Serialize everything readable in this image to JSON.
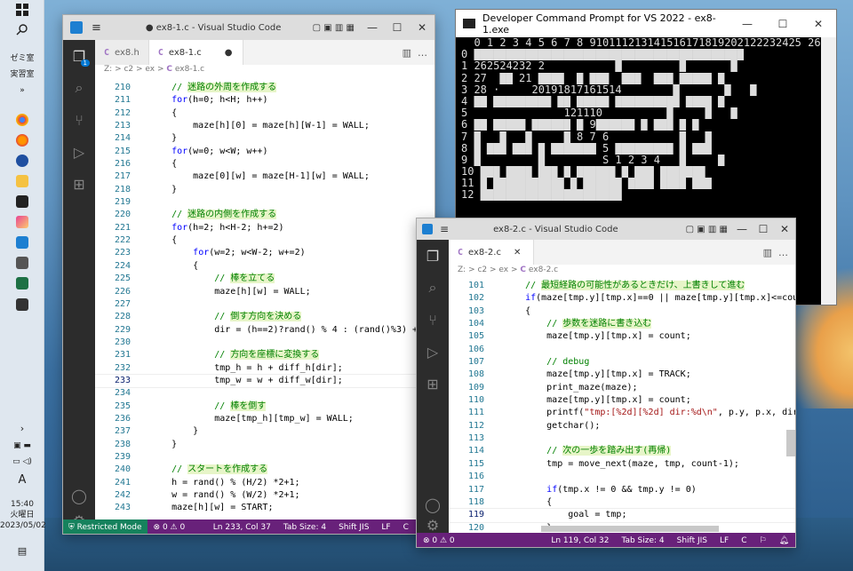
{
  "taskbar": {
    "items": [
      {
        "label": "ゼミ室"
      },
      {
        "label": "実習室"
      },
      {
        "label": "»"
      }
    ],
    "lang": "A",
    "time": "15:40",
    "day": "火曜日",
    "date": "2023/05/02"
  },
  "win1": {
    "title": "● ex8-1.c - Visual Studio Code",
    "tabs": [
      {
        "label": "ex8.h",
        "icon": "C"
      },
      {
        "label": "ex8-1.c",
        "icon": "C",
        "dirty": "●"
      }
    ],
    "breadcrumb": [
      "Z:",
      "c2",
      "ex",
      "C",
      "ex8-1.c"
    ],
    "badge": "1",
    "lines": [
      {
        "n": "210",
        "t": "    // 迷路の外周を作成する"
      },
      {
        "n": "211",
        "t": "    for(h=0; h<H; h++)"
      },
      {
        "n": "212",
        "t": "    {"
      },
      {
        "n": "213",
        "t": "        maze[h][0] = maze[h][W-1] = WALL;"
      },
      {
        "n": "214",
        "t": "    }"
      },
      {
        "n": "215",
        "t": "    for(w=0; w<W; w++)"
      },
      {
        "n": "216",
        "t": "    {"
      },
      {
        "n": "217",
        "t": "        maze[0][w] = maze[H-1][w] = WALL;"
      },
      {
        "n": "218",
        "t": "    }"
      },
      {
        "n": "219",
        "t": ""
      },
      {
        "n": "220",
        "t": "    // 迷路の内側を作成する"
      },
      {
        "n": "221",
        "t": "    for(h=2; h<H-2; h+=2)"
      },
      {
        "n": "222",
        "t": "    {"
      },
      {
        "n": "223",
        "t": "        for(w=2; w<W-2; w+=2)"
      },
      {
        "n": "224",
        "t": "        {"
      },
      {
        "n": "225",
        "t": "            // 棒を立てる"
      },
      {
        "n": "226",
        "t": "            maze[h][w] = WALL;"
      },
      {
        "n": "227",
        "t": ""
      },
      {
        "n": "228",
        "t": "            // 倒す方向を決める"
      },
      {
        "n": "229",
        "t": "            dir = (h==2)?rand() % 4 : (rand()%3) + 1;"
      },
      {
        "n": "230",
        "t": ""
      },
      {
        "n": "231",
        "t": "            // 方向を座標に変換する"
      },
      {
        "n": "232",
        "t": "            tmp_h = h + diff_h[dir];"
      },
      {
        "n": "233",
        "t": "            tmp_w = w + diff_w[dir];"
      },
      {
        "n": "234",
        "t": ""
      },
      {
        "n": "235",
        "t": "            // 棒を倒す"
      },
      {
        "n": "236",
        "t": "            maze[tmp_h][tmp_w] = WALL;"
      },
      {
        "n": "237",
        "t": "        }"
      },
      {
        "n": "238",
        "t": "    }"
      },
      {
        "n": "239",
        "t": ""
      },
      {
        "n": "240",
        "t": "    // スタートを作成する"
      },
      {
        "n": "241",
        "t": "    h = rand() % (H/2) *2+1;"
      },
      {
        "n": "242",
        "t": "    w = rand() % (W/2) *2+1;"
      },
      {
        "n": "243",
        "t": "    maze[h][w] = START;"
      }
    ],
    "status": {
      "mode": "Restricted Mode",
      "problems": "⊗ 0 ⚠ 0",
      "position": "Ln 233, Col 37",
      "tab": "Tab Size: 4",
      "encoding": "Shift JIS",
      "eol": "LF",
      "lang": "C"
    }
  },
  "console": {
    "title": "Developer Command Prompt for VS 2022 - ex8-1.exe",
    "lines": [
      "  0 1 2 3 4 5 6 7 8 910111213141516171819202122232425 26",
      "0 ██████████████████████████████████████████",
      "1 262524232 2           █         █       █",
      "2 27  ██ 21 ████  █ ███  ███  ███ █████ █",
      "3 28 ·     20191817161514        █       █   █",
      "4 ██ █████████ ██ █████ ██████████ ████ █",
      "5               121110          █     █   █",
      "6 ██ █████ ██████ █ 9██████ █ ███ █ █",
      "7 █   █   █     █ 8 7 6           █   █",
      "8 █ ███ ███ █ ███████ 5 █████████ █ ███",
      "9 █         █         S 1 2 3 4   █     █",
      "10 ███ ████ ███ █ ██████ █ ███ ███████",
      "11 █ ███████████ █ ██████ ████ ████ ███",
      "12 ██████████████████████"
    ]
  },
  "win2": {
    "title": "ex8-2.c - Visual Studio Code",
    "tabs": [
      {
        "label": "ex8-2.c",
        "icon": "C"
      }
    ],
    "breadcrumb": [
      "Z:",
      "c2",
      "ex",
      "C",
      "ex8-2.c"
    ],
    "lines": [
      {
        "n": "101",
        "t": "    // 最短経路の可能性があるときだけ、上書きして進む"
      },
      {
        "n": "102",
        "t": "    if(maze[tmp.y][tmp.x]==0 || maze[tmp.y][tmp.x]<=count)"
      },
      {
        "n": "103",
        "t": "    {"
      },
      {
        "n": "104",
        "t": "        // 歩数を迷路に書き込む"
      },
      {
        "n": "105",
        "t": "        maze[tmp.y][tmp.x] = count;"
      },
      {
        "n": "106",
        "t": ""
      },
      {
        "n": "107",
        "t": "        // debug"
      },
      {
        "n": "108",
        "t": "        maze[tmp.y][tmp.x] = TRACK;"
      },
      {
        "n": "109",
        "t": "        print_maze(maze);"
      },
      {
        "n": "110",
        "t": "        maze[tmp.y][tmp.x] = count;"
      },
      {
        "n": "111",
        "t": "        printf(\"tmp:[%2d][%2d] dir:%d\\n\", p.y, p.x, dir);"
      },
      {
        "n": "112",
        "t": "        getchar();"
      },
      {
        "n": "113",
        "t": ""
      },
      {
        "n": "114",
        "t": "        // 次の一歩を踏み出す(再帰)"
      },
      {
        "n": "115",
        "t": "        tmp = move_next(maze, tmp, count-1);"
      },
      {
        "n": "116",
        "t": ""
      },
      {
        "n": "117",
        "t": "        if(tmp.x != 0 && tmp.y != 0)"
      },
      {
        "n": "118",
        "t": "        {"
      },
      {
        "n": "119",
        "t": "            goal = tmp;"
      },
      {
        "n": "120",
        "t": "        }"
      }
    ],
    "status": {
      "problems": "⊗ 0 ⚠ 0",
      "position": "Ln 119, Col 32",
      "tab": "Tab Size: 4",
      "encoding": "Shift JIS",
      "eol": "LF",
      "lang": "C"
    }
  },
  "colors": {
    "statusbar": "#68217a",
    "activity": "#2c2c2c",
    "comment": "#008000",
    "keyword": "#0000ff",
    "lineNumber": "#237893"
  }
}
